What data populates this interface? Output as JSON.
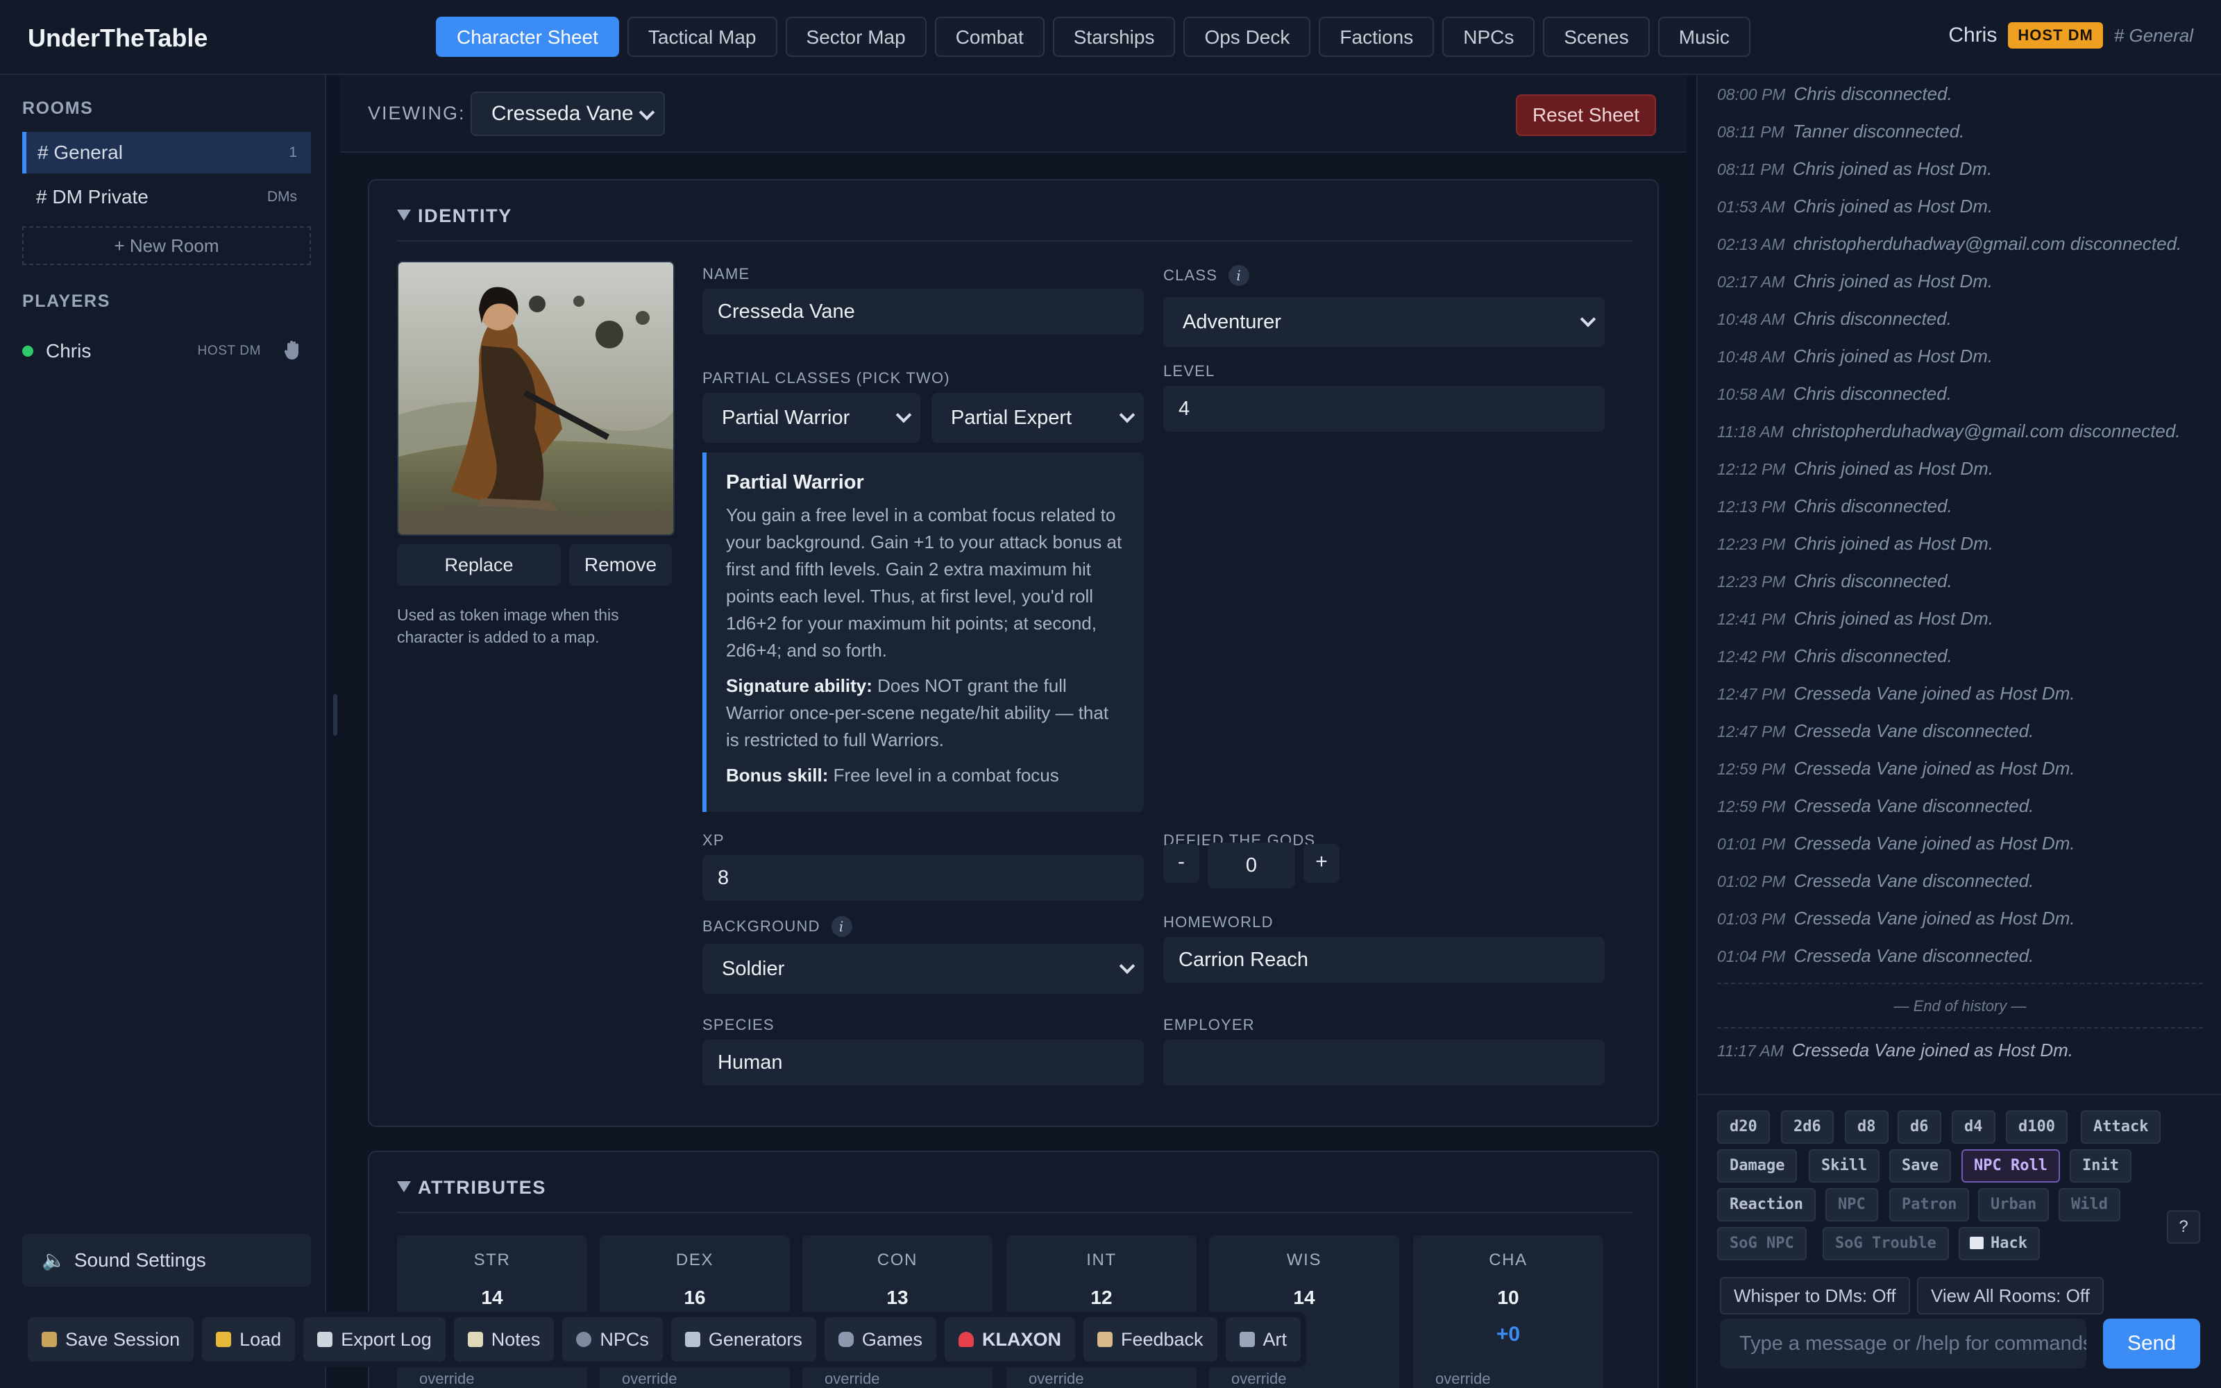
{
  "app": {
    "title": "UnderTheTable"
  },
  "nav": {
    "tabs": [
      "Character Sheet",
      "Tactical Map",
      "Sector Map",
      "Combat",
      "Starships",
      "Ops Deck",
      "Factions",
      "NPCs",
      "Scenes",
      "Music"
    ],
    "active": "Character Sheet"
  },
  "user": {
    "name": "Chris",
    "badge": "HOST DM",
    "room": "# General"
  },
  "sidebar": {
    "rooms_heading": "ROOMS",
    "rooms": [
      {
        "label": "# General",
        "count": "1"
      },
      {
        "label": "# DM Private",
        "count": "DMs"
      }
    ],
    "new_room": "+ New Room",
    "players_heading": "PLAYERS",
    "players": [
      {
        "name": "Chris",
        "role": "HOST DM",
        "icon": "hand-icon"
      }
    ],
    "sound_settings": "Sound Settings"
  },
  "viewing": {
    "label": "VIEWING:",
    "selected": "Cresseda Vane",
    "reset": "Reset Sheet"
  },
  "identity": {
    "heading": "IDENTITY",
    "replace": "Replace",
    "remove": "Remove",
    "portrait_note": "Used as token image when this character is added to a map.",
    "name_label": "NAME",
    "name": "Cresseda Vane",
    "class_label": "CLASS",
    "class": "Adventurer",
    "partial_label": "PARTIAL CLASSES (PICK TWO)",
    "partial1": "Partial Warrior",
    "partial2": "Partial Expert",
    "level_label": "LEVEL",
    "level": "4",
    "desc_title": "Partial Warrior",
    "desc_body": "You gain a free level in a combat focus related to your background. Gain +1 to your attack bonus at first and fifth levels. Gain 2 extra maximum hit points each level. Thus, at first level, you'd roll 1d6+2 for your maximum hit points; at second, 2d6+4; and so forth.",
    "desc_sig_label": "Signature ability:",
    "desc_sig": " Does NOT grant the full Warrior once-per-scene negate/hit ability — that is restricted to full Warriors.",
    "desc_bonus_label": "Bonus skill:",
    "desc_bonus": " Free level in a combat focus",
    "xp_label": "XP",
    "xp": "8",
    "defied_label": "DEFIED THE GODS",
    "defied": "0",
    "minus": "-",
    "plus": "+",
    "background_label": "BACKGROUND",
    "background": "Soldier",
    "homeworld_label": "HOMEWORLD",
    "homeworld": "Carrion Reach",
    "species_label": "SPECIES",
    "species": "Human",
    "employer_label": "EMPLOYER",
    "employer": ""
  },
  "attributes": {
    "heading": "ATTRIBUTES",
    "override": "override",
    "items": [
      {
        "name": "STR",
        "value": "14",
        "mod": ""
      },
      {
        "name": "DEX",
        "value": "16",
        "mod": ""
      },
      {
        "name": "CON",
        "value": "13",
        "mod": ""
      },
      {
        "name": "INT",
        "value": "12",
        "mod": ""
      },
      {
        "name": "WIS",
        "value": "14",
        "mod": ""
      },
      {
        "name": "CHA",
        "value": "10",
        "mod": "+0"
      }
    ]
  },
  "toolbar": [
    {
      "label": "Save Session",
      "icon": "save-icon",
      "color": "#c9a45c"
    },
    {
      "label": "Load",
      "icon": "folder-icon",
      "color": "#e7b93a"
    },
    {
      "label": "Export Log",
      "icon": "document-icon",
      "color": "#cfd5df"
    },
    {
      "label": "Notes",
      "icon": "notes-icon",
      "color": "#e0d9b9"
    },
    {
      "label": "NPCs",
      "icon": "people-icon",
      "color": "#7d8aa0"
    },
    {
      "label": "Generators",
      "icon": "generator-icon",
      "color": "#b9c2d1"
    },
    {
      "label": "Games",
      "icon": "gamepad-icon",
      "color": "#8c98ad"
    },
    {
      "label": "KLAXON",
      "icon": "siren-icon",
      "color": "#e5414a"
    },
    {
      "label": "Feedback",
      "icon": "clipboard-icon",
      "color": "#d9b88a"
    },
    {
      "label": "Art",
      "icon": "art-icon",
      "color": "#9aa6ba"
    }
  ],
  "chat": {
    "messages": [
      {
        "time": "08:00 PM",
        "text": "Chris disconnected."
      },
      {
        "time": "08:11 PM",
        "text": "Tanner disconnected."
      },
      {
        "time": "08:11 PM",
        "text": "Chris joined as Host Dm."
      },
      {
        "time": "01:53 AM",
        "text": "Chris joined as Host Dm."
      },
      {
        "time": "02:13 AM",
        "text": "christopherduhadway@gmail.com disconnected."
      },
      {
        "time": "02:17 AM",
        "text": "Chris joined as Host Dm."
      },
      {
        "time": "10:48 AM",
        "text": "Chris disconnected."
      },
      {
        "time": "10:48 AM",
        "text": "Chris joined as Host Dm."
      },
      {
        "time": "10:58 AM",
        "text": "Chris disconnected."
      },
      {
        "time": "11:18 AM",
        "text": "christopherduhadway@gmail.com disconnected."
      },
      {
        "time": "12:12 PM",
        "text": "Chris joined as Host Dm."
      },
      {
        "time": "12:13 PM",
        "text": "Chris disconnected."
      },
      {
        "time": "12:23 PM",
        "text": "Chris joined as Host Dm."
      },
      {
        "time": "12:23 PM",
        "text": "Chris disconnected."
      },
      {
        "time": "12:41 PM",
        "text": "Chris joined as Host Dm."
      },
      {
        "time": "12:42 PM",
        "text": "Chris disconnected."
      },
      {
        "time": "12:47 PM",
        "text": "Cresseda Vane joined as Host Dm."
      },
      {
        "time": "12:47 PM",
        "text": "Cresseda Vane disconnected."
      },
      {
        "time": "12:59 PM",
        "text": "Cresseda Vane joined as Host Dm."
      },
      {
        "time": "12:59 PM",
        "text": "Cresseda Vane disconnected."
      },
      {
        "time": "01:01 PM",
        "text": "Cresseda Vane joined as Host Dm."
      },
      {
        "time": "01:02 PM",
        "text": "Cresseda Vane disconnected."
      },
      {
        "time": "01:03 PM",
        "text": "Cresseda Vane joined as Host Dm."
      },
      {
        "time": "01:04 PM",
        "text": "Cresseda Vane disconnected."
      }
    ],
    "end_history": "— End of history —",
    "latest": {
      "time": "11:17 AM",
      "text": "Cresseda Vane joined as Host Dm."
    },
    "dice_chips": [
      "d20",
      "2d6",
      "d8",
      "d6",
      "d4",
      "d100",
      "Attack",
      "Damage",
      "Skill",
      "Save",
      "NPC Roll",
      "Init",
      "Reaction",
      "NPC",
      "Patron",
      "Urban",
      "Wild",
      "SoG NPC",
      "SoG Trouble",
      "Hack"
    ],
    "help": "?",
    "whisper": "Whisper to DMs: Off",
    "view_all": "View All Rooms: Off",
    "placeholder": "Type a message or /help for commands",
    "send": "Send"
  }
}
